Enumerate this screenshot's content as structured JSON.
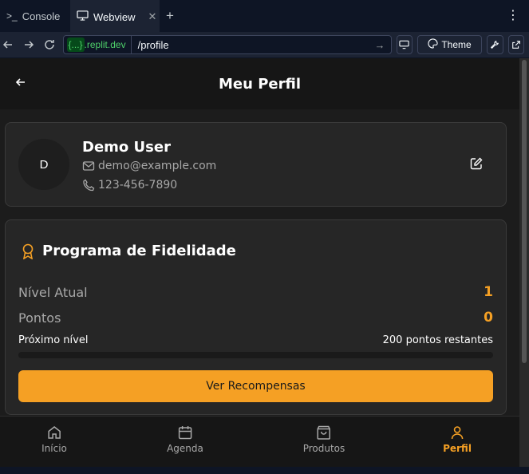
{
  "tabs": [
    {
      "label": "Console",
      "icon": "terminal-icon"
    },
    {
      "label": "Webview",
      "icon": "monitor-icon",
      "active": true
    }
  ],
  "urlbar": {
    "domain_chip": "{...}",
    "domain_rest": ".replit.dev",
    "path": "/profile",
    "theme_label": "Theme"
  },
  "app": {
    "title": "Meu Perfil",
    "user": {
      "initial": "D",
      "name": "Demo User",
      "email": "demo@example.com",
      "phone": "123-456-7890"
    },
    "loyalty": {
      "title": "Programa de Fidelidade",
      "level_label": "Nível Atual",
      "level_value": "1",
      "points_label": "Pontos",
      "points_value": "0",
      "next_label": "Próximo nível",
      "remaining_label": "200 pontos restantes",
      "progress_percent": 0,
      "button_label": "Ver Recompensas"
    },
    "nav": [
      {
        "label": "Início",
        "icon": "home-icon"
      },
      {
        "label": "Agenda",
        "icon": "calendar-icon"
      },
      {
        "label": "Produtos",
        "icon": "shopping-bag-icon"
      },
      {
        "label": "Perfil",
        "icon": "user-icon",
        "active": true
      }
    ]
  },
  "colors": {
    "accent": "#f5a024",
    "background": "#1c1c1c",
    "card": "#262626"
  }
}
